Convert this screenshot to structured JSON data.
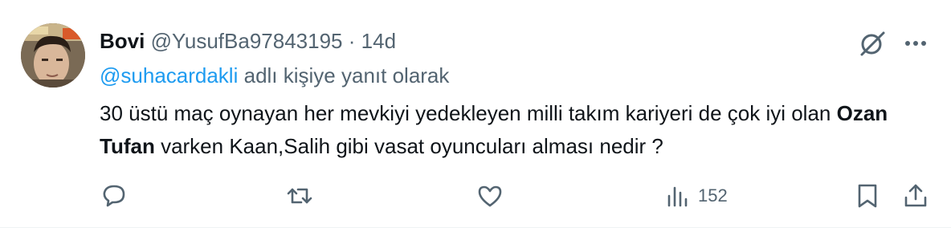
{
  "tweet": {
    "display_name": "Bovi",
    "handle": "@YusufBa97843195",
    "separator": "·",
    "time": "14d",
    "reply_mention": "@suhacardakli",
    "reply_suffix": "adlı kişiye yanıt olarak",
    "text_before": "30 üstü maç oynayan her mevkiyi yedekleyen milli takım kariyeri de çok iyi olan ",
    "text_bold": "Ozan Tufan",
    "text_after": " varken Kaan,Salih gibi vasat oyuncuları alması nedir ?",
    "views_count": "152"
  },
  "colors": {
    "text": "#0f1419",
    "muted": "#536471",
    "link": "#1d9bf0"
  },
  "icons": [
    "grok-icon",
    "more-icon",
    "reply-icon",
    "retweet-icon",
    "like-icon",
    "views-icon",
    "bookmark-icon",
    "share-icon"
  ]
}
